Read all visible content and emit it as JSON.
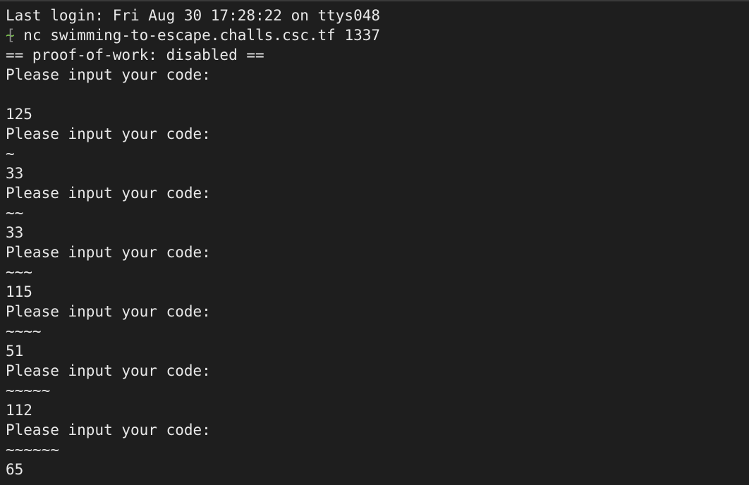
{
  "terminal": {
    "lines": [
      "Last login: Fri Aug 30 17:28:22 on ttys048",
      "",
      "== proof-of-work: disabled ==",
      "Please input your code:",
      "",
      "125",
      "Please input your code:",
      "~",
      "33",
      "Please input your code:",
      "~~",
      "33",
      "Please input your code:",
      "~~~",
      "115",
      "Please input your code:",
      "~~~~",
      "51",
      "Please input your code:",
      "~~~~~",
      "112",
      "Please input your code:",
      "~~~~~~",
      "65"
    ],
    "prompt": {
      "bracket": "[",
      "cwd": "~",
      "command": " nc swimming-to-escape.challs.csc.tf 1337"
    }
  },
  "colors": {
    "background": "#1e1e1e",
    "text": "#e8e8e8",
    "prompt_cwd": "#7ec850"
  }
}
